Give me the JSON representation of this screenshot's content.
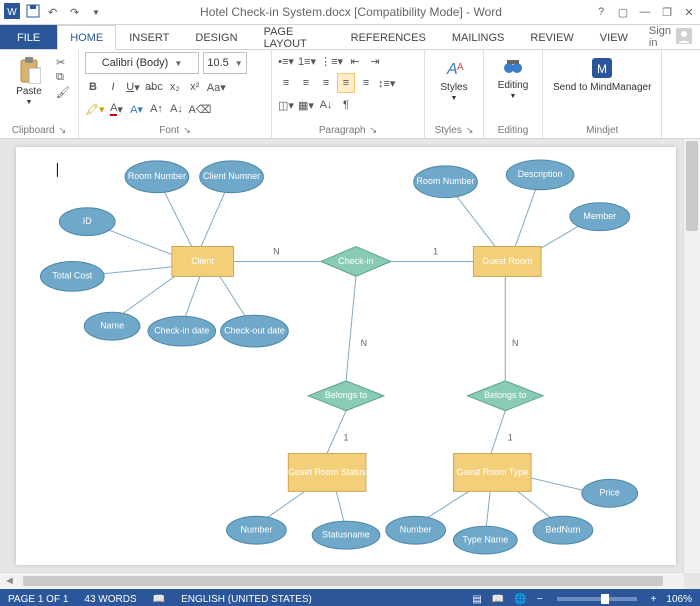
{
  "title": "Hotel Check-in System.docx [Compatibility Mode] - Word",
  "signin": "Sign in",
  "tabs": {
    "file": "FILE",
    "home": "HOME",
    "insert": "INSERT",
    "design": "DESIGN",
    "layout": "PAGE LAYOUT",
    "references": "REFERENCES",
    "mailings": "MAILINGS",
    "review": "REVIEW",
    "view": "VIEW"
  },
  "groups": {
    "clipboard": "Clipboard",
    "font": "Font",
    "paragraph": "Paragraph",
    "styles": "Styles",
    "editing": "Editing",
    "mindjet": "Mindjet"
  },
  "ribbon": {
    "paste": "Paste",
    "fontName": "Calibri (Body)",
    "fontSize": "10.5",
    "styles": "Styles",
    "editing": "Editing",
    "mindmgr": "Send to MindManager"
  },
  "er": {
    "entities": {
      "client": "Client",
      "guestRoom": "Guest Room",
      "guestRoomStatus": "Guset Room Status",
      "guestRoomType": "Guest Room Type"
    },
    "relationships": {
      "checkin": "Check-in",
      "belongs1": "Belongs to",
      "belongs2": "Belongs to"
    },
    "attrs": {
      "roomNumber1": "Room Number",
      "clientNumber": "Client Numner",
      "id": "ID",
      "totalCost": "Total Cost",
      "name": "Name",
      "checkinDate": "Check-in date",
      "checkoutDate": "Check-out date",
      "roomNumber2": "Room Number",
      "description": "Description",
      "member": "Member",
      "statusNumber": "Number",
      "statusName": "Statusname",
      "typeNumber": "Number",
      "typeName": "Type Name",
      "bedNum": "BedNum",
      "price": "Price"
    },
    "card": {
      "n": "N",
      "one": "1"
    }
  },
  "status": {
    "page": "PAGE 1 OF 1",
    "words": "43 WORDS",
    "lang": "ENGLISH (UNITED STATES)",
    "zoom": "106%"
  }
}
